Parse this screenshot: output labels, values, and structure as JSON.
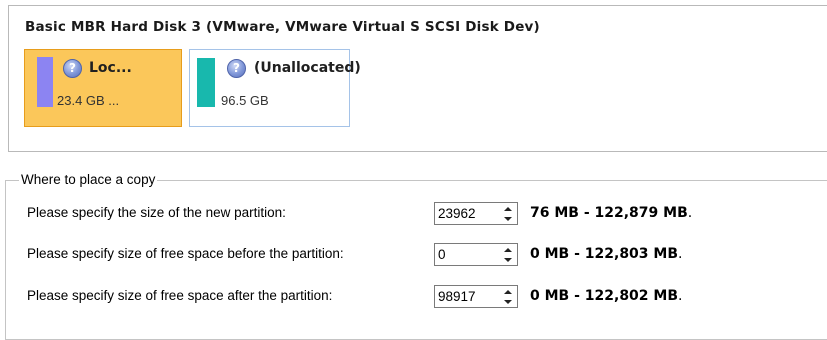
{
  "disk": {
    "title": "Basic MBR Hard Disk 3 (VMware, VMware Virtual S SCSI Disk Dev)",
    "partitions": [
      {
        "name": "Loc...",
        "size": "23.4 GB ...",
        "color": "#8c84f2",
        "icon": "question-disk-icon",
        "selected": true
      },
      {
        "name": "(Unallocated)",
        "size": "96.5 GB",
        "color": "#18b8ad",
        "icon": "question-disk-icon",
        "selected": false
      }
    ]
  },
  "placement": {
    "group_label": "Where to place a copy",
    "rows": [
      {
        "label": "Please specify the size of the new partition:",
        "value": "23962",
        "range": "76 MB - 122,879 MB"
      },
      {
        "label": "Please specify size of free space before the partition:",
        "value": "0",
        "range": "0 MB - 122,803 MB"
      },
      {
        "label": "Please specify size of free space after the partition:",
        "value": "98917",
        "range": "0 MB - 122,802 MB"
      }
    ]
  },
  "colors": {
    "selection_fill": "#fbc75a",
    "selection_border": "#e79d1c",
    "partition_border": "#a5c3e8"
  }
}
